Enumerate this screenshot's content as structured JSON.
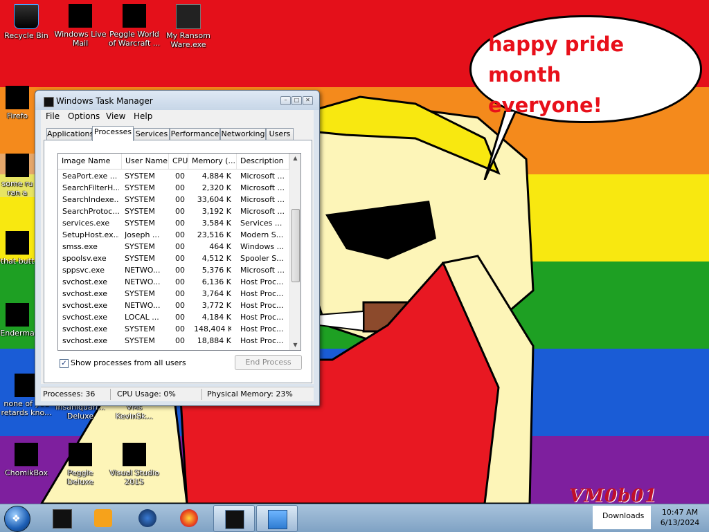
{
  "desktop": {
    "stripes": [
      "#e4101a",
      "#f48a1c",
      "#f8e810",
      "#1ea023",
      "#1a5cd6",
      "#7e1f9e"
    ],
    "speech_bubble": "happy pride month everyone!",
    "watermark": "VM0b01",
    "icons": [
      {
        "label": "Recycle Bin",
        "icon": "recycle-bin-icon"
      },
      {
        "label": "Windows Live Mail",
        "icon": "mail-icon"
      },
      {
        "label": "Peggle World of Warcraft ...",
        "icon": "peggle-icon"
      },
      {
        "label": "My Ransom Ware.exe",
        "icon": "console-icon"
      },
      {
        "label": "Firefo",
        "icon": "firefox-icon"
      },
      {
        "label": "some ru ran a",
        "icon": "file-icon"
      },
      {
        "label": "that butt",
        "icon": "file-icon"
      },
      {
        "label": "Enderma",
        "icon": "app-icon"
      },
      {
        "label": "none of you retards kno...",
        "icon": "file-icon"
      },
      {
        "label": "Insaniquari... Deluxe",
        "icon": "app-icon"
      },
      {
        "label": "VMs KevinSk...",
        "icon": "folder-icon"
      },
      {
        "label": "ChomikBox",
        "icon": "chomikbox-icon"
      },
      {
        "label": "Peggle Deluxe",
        "icon": "peggle-icon"
      },
      {
        "label": "Visual Studio 2015",
        "icon": "visual-studio-icon"
      }
    ]
  },
  "task_manager": {
    "title": "Windows Task Manager",
    "menu": [
      "File",
      "Options",
      "View",
      "Help"
    ],
    "tabs": [
      "Applications",
      "Processes",
      "Services",
      "Performance",
      "Networking",
      "Users"
    ],
    "active_tab": "Processes",
    "columns": [
      "Image Name",
      "User Name",
      "CPU",
      "Memory (...",
      "Description"
    ],
    "rows": [
      {
        "name": "SeaPort.exe ...",
        "user": "SYSTEM",
        "cpu": "00",
        "mem": "4,884 K",
        "desc": "Microsoft ..."
      },
      {
        "name": "SearchFilterH...",
        "user": "SYSTEM",
        "cpu": "00",
        "mem": "2,320 K",
        "desc": "Microsoft ..."
      },
      {
        "name": "SearchIndexe...",
        "user": "SYSTEM",
        "cpu": "00",
        "mem": "33,604 K",
        "desc": "Microsoft ..."
      },
      {
        "name": "SearchProtoc...",
        "user": "SYSTEM",
        "cpu": "00",
        "mem": "3,192 K",
        "desc": "Microsoft ..."
      },
      {
        "name": "services.exe",
        "user": "SYSTEM",
        "cpu": "00",
        "mem": "3,584 K",
        "desc": "Services ..."
      },
      {
        "name": "SetupHost.ex...",
        "user": "Joseph ...",
        "cpu": "00",
        "mem": "23,516 K",
        "desc": "Modern S..."
      },
      {
        "name": "smss.exe",
        "user": "SYSTEM",
        "cpu": "00",
        "mem": "464 K",
        "desc": "Windows ..."
      },
      {
        "name": "spoolsv.exe",
        "user": "SYSTEM",
        "cpu": "00",
        "mem": "4,512 K",
        "desc": "Spooler S..."
      },
      {
        "name": "sppsvc.exe",
        "user": "NETWO...",
        "cpu": "00",
        "mem": "5,376 K",
        "desc": "Microsoft ..."
      },
      {
        "name": "svchost.exe",
        "user": "NETWO...",
        "cpu": "00",
        "mem": "6,136 K",
        "desc": "Host Proc..."
      },
      {
        "name": "svchost.exe",
        "user": "SYSTEM",
        "cpu": "00",
        "mem": "3,764 K",
        "desc": "Host Proc..."
      },
      {
        "name": "svchost.exe",
        "user": "NETWO...",
        "cpu": "00",
        "mem": "3,772 K",
        "desc": "Host Proc..."
      },
      {
        "name": "svchost.exe",
        "user": "LOCAL ...",
        "cpu": "00",
        "mem": "4,184 K",
        "desc": "Host Proc..."
      },
      {
        "name": "svchost.exe",
        "user": "SYSTEM",
        "cpu": "00",
        "mem": "148,404 K",
        "desc": "Host Proc..."
      },
      {
        "name": "svchost.exe",
        "user": "SYSTEM",
        "cpu": "00",
        "mem": "18,884 K",
        "desc": "Host Proc..."
      }
    ],
    "show_all_label": "Show processes from all users",
    "show_all_checked": true,
    "end_process_label": "End Process",
    "status": {
      "processes": "Processes: 36",
      "cpu": "CPU Usage: 0%",
      "memory": "Physical Memory: 23%"
    }
  },
  "taskbar": {
    "pinned": [
      {
        "icon": "black-box-icon"
      },
      {
        "icon": "media-player-icon"
      },
      {
        "icon": "globe-icon"
      },
      {
        "icon": "firefox-icon"
      },
      {
        "icon": "task-manager-icon"
      },
      {
        "icon": "explorer-icon"
      }
    ],
    "tray_label": "Downloads",
    "time": "10:47 AM",
    "date": "6/13/2024"
  }
}
